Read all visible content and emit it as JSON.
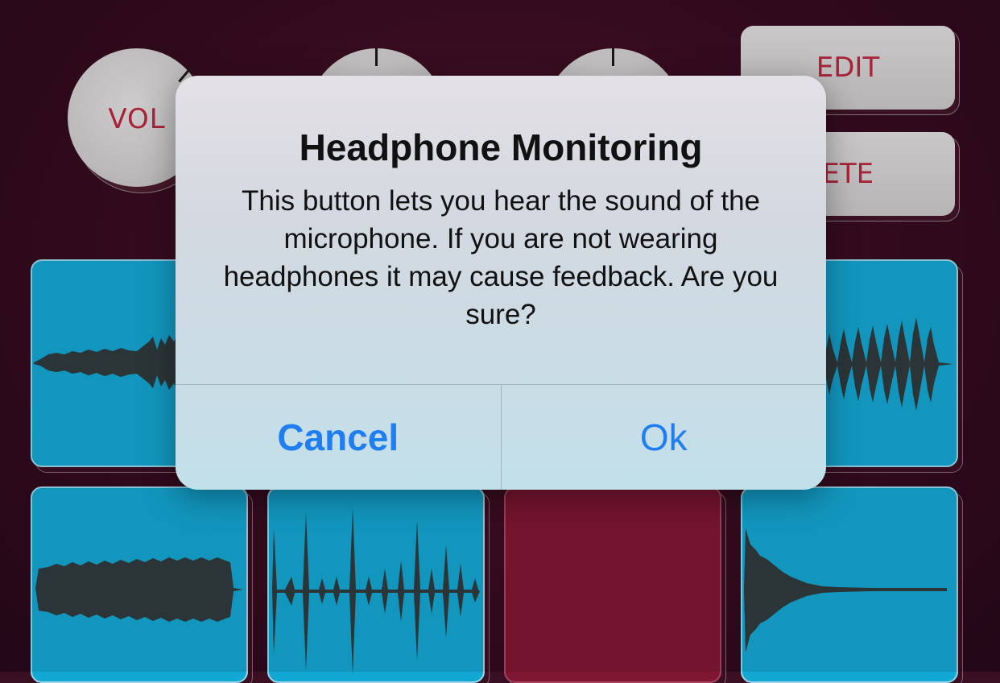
{
  "knobs": {
    "vol_label": "VOL"
  },
  "side_buttons": {
    "edit_label": "EDIT",
    "delete_label": "ELETE"
  },
  "pads": [
    {
      "name": "pad-1",
      "color": "blue",
      "waveform": "sustained-noise"
    },
    {
      "name": "pad-4",
      "color": "blue",
      "waveform": "rhythmic-hits"
    },
    {
      "name": "pad-5",
      "color": "blue",
      "waveform": "sustained-noise"
    },
    {
      "name": "pad-6",
      "color": "blue",
      "waveform": "rhythmic-hits"
    },
    {
      "name": "pad-7",
      "color": "red",
      "waveform": "empty"
    },
    {
      "name": "pad-8",
      "color": "blue",
      "waveform": "decaying-hit"
    }
  ],
  "alert": {
    "title": "Headphone Monitoring",
    "message": "This button lets you hear the sound of the microphone. If you are not wearing headphones it may cause feedback. Are you sure?",
    "cancel_label": "Cancel",
    "ok_label": "Ok"
  },
  "colors": {
    "background": "#3a0f22",
    "pad_blue": "#12a8d3",
    "pad_red": "#7f1733",
    "accent_text": "#b8273f",
    "alert_button": "#1e7ef2"
  }
}
